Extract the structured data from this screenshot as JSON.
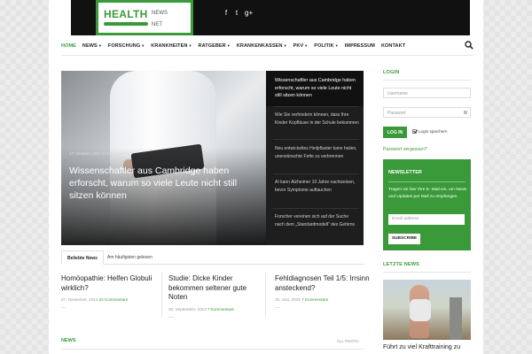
{
  "logo": {
    "word1": "HEALTH",
    "word2": "NEWS",
    "word3": "NET"
  },
  "social": {
    "facebook": "f",
    "twitter": "t",
    "googleplus": "g+"
  },
  "nav": {
    "home": "HOME",
    "news": "NEWS",
    "forschung": "FORSCHUNG",
    "krankheiten": "KRANKHEITEN",
    "ratgeber": "RATGEBER",
    "krankenkassen": "KRANKENKASSEN",
    "pkv": "PKV",
    "politik": "POLITIK",
    "impressum": "IMPRESSUM",
    "kontakt": "KONTAKT"
  },
  "hero": {
    "meta": "17. Oktober, 2017  0 Kommentare",
    "title": "Wissenschaftler aus Cambridge haben erforscht, warum so viele Leute nicht still sitzen können",
    "list": [
      "Wissenschaftler aus Cambridge haben erforscht, warum so viele Leute nicht still sitzen können",
      "Wie Sie verhindern können, dass Ihre Kinder Kopfläuse in der Schule bekommen",
      "Neu entwickeltes Heilpflaster kann heilen, unerwünschte Fette zu verbrennen",
      "AI kann Alzheimer 10 Jahre nachweisen, bevor Symptome auftauchen",
      "Forscher vereinen sich auf der Suche nach dem „Standardmodell“ des Gehirns"
    ]
  },
  "tabs": {
    "popular": "Beliebte News",
    "most_read": "Am häufigsten gelesen"
  },
  "articles": [
    {
      "title": "Homöopathie: Helfen Globuli wirklich?",
      "date": "07. November, 2013",
      "comments": "32 Kommentare",
      "more": "..."
    },
    {
      "title": "Studie: Dicke Kinder bekommen seltener gute Noten",
      "date": "30. September, 2013",
      "comments": "7 Kommentare",
      "more": "..."
    },
    {
      "title": "Fehldiagnosen Teil 1/5: Irrsinn ansteckend?",
      "date": "15. Juni, 2015",
      "comments": "7 Kommentare",
      "more": "..."
    }
  ],
  "news_section": {
    "title": "NEWS",
    "all_posts": "ALL POSTS"
  },
  "login": {
    "title": "LOGIN",
    "username_placeholder": "Username",
    "password_placeholder": "Passwort",
    "button": "LOG IN",
    "remember": "Login speichern",
    "forgot": "Passwort vergessen?"
  },
  "newsletter": {
    "title": "NEWSLETTER",
    "text": "Tragen sie hier Ihre E- Mail ein, um News und Updates per Mail zu empfangen.",
    "email_placeholder": "Email address",
    "button": "SUBSCRIBE"
  },
  "latest": {
    "title": "LETZTE NEWS",
    "caption": "Führt zu viel Krafttraining zu"
  },
  "colors": {
    "accent": "#3a9a3a",
    "topbar": "#111111"
  }
}
